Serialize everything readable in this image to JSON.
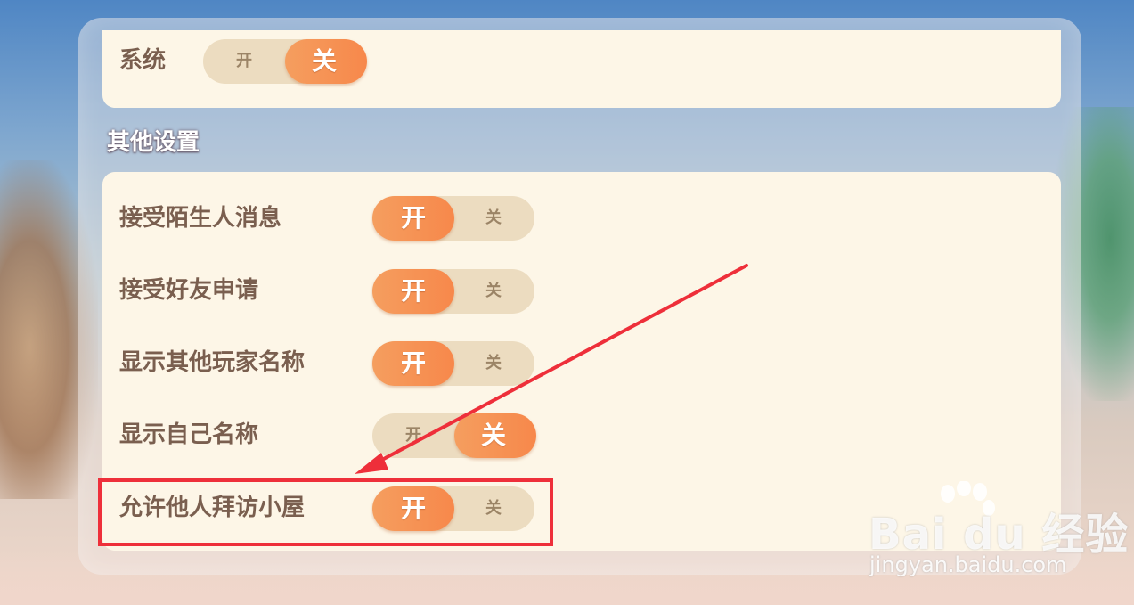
{
  "system_row": {
    "label": "系统",
    "on_label": "开",
    "off_label": "关",
    "state": "off"
  },
  "section_title": "其他设置",
  "settings": [
    {
      "label": "接受陌生人消息",
      "on_label": "开",
      "off_label": "关",
      "state": "on"
    },
    {
      "label": "接受好友申请",
      "on_label": "开",
      "off_label": "关",
      "state": "on"
    },
    {
      "label": "显示其他玩家名称",
      "on_label": "开",
      "off_label": "关",
      "state": "on"
    },
    {
      "label": "显示自己名称",
      "on_label": "开",
      "off_label": "关",
      "state": "off"
    },
    {
      "label": "允许他人拜访小屋",
      "on_label": "开",
      "off_label": "关",
      "state": "on"
    }
  ],
  "annotation": {
    "color": "#ee2f3a",
    "target": "允许他人拜访小屋"
  },
  "watermark": {
    "logo": "Bai du 经验",
    "url": "jingyan.baidu.com"
  },
  "colors": {
    "accent": "#f7884b",
    "toggle_track": "#ecdcc0",
    "card": "#fdf6e7",
    "label": "#7a5f4f"
  }
}
